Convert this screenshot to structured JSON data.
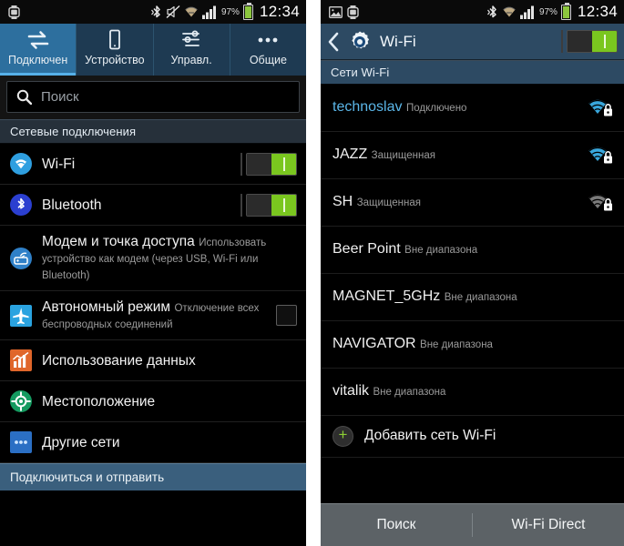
{
  "statusbar_left": {
    "time": "12:34",
    "battery_pct": "97%",
    "icons_left": [
      "gallery-icon",
      "watch-icon"
    ],
    "icons_right": [
      "bluetooth-icon",
      "mute-icon",
      "wifi-icon",
      "signal-icon"
    ]
  },
  "statusbar_right": {
    "time": "12:34",
    "battery_pct": "97%",
    "icons_left": [
      "gallery-icon",
      "watch-icon"
    ],
    "icons_right": [
      "bluetooth-icon",
      "wifi-icon",
      "signal-icon"
    ]
  },
  "left_screen": {
    "tabs": [
      {
        "label": "Подключен",
        "icon": "connections-arrows-icon",
        "active": true
      },
      {
        "label": "Устройство",
        "icon": "device-phone-icon",
        "active": false
      },
      {
        "label": "Управл.",
        "icon": "sliders-icon",
        "active": false
      },
      {
        "label": "Общие",
        "icon": "more-dots-icon",
        "active": false
      }
    ],
    "search": {
      "placeholder": "Поиск",
      "icon": "search-icon",
      "value": ""
    },
    "section_title": "Сетевые подключения",
    "rows": [
      {
        "title": "Wi-Fi",
        "sub": "",
        "icon": "wifi-round-icon",
        "control": "toggle-on"
      },
      {
        "title": "Bluetooth",
        "sub": "",
        "icon": "bluetooth-round-icon",
        "control": "toggle-on"
      },
      {
        "title": "Модем и точка доступа",
        "sub": "Использовать устройство как модем (через USB, Wi-Fi или Bluetooth)",
        "icon": "tethering-round-icon",
        "control": "none"
      },
      {
        "title": "Автономный режим",
        "sub": "Отключение всех беспроводных соединений",
        "icon": "airplane-square-icon",
        "control": "checkbox-off"
      },
      {
        "title": "Использование данных",
        "sub": "",
        "icon": "data-usage-square-icon",
        "control": "none"
      },
      {
        "title": "Местоположение",
        "sub": "",
        "icon": "location-round-icon",
        "control": "none"
      },
      {
        "title": "Другие сети",
        "sub": "",
        "icon": "more-networks-square-icon",
        "control": "none"
      }
    ],
    "bottom_bar": "Подключиться и отправить"
  },
  "right_screen": {
    "header": {
      "title": "Wi-Fi",
      "back_icon": "back-chevron-icon",
      "gear_icon": "wifi-settings-gear-icon",
      "toggle": "toggle-on"
    },
    "section_title": "Сети Wi-Fi",
    "networks": [
      {
        "ssid": "technoslav",
        "state": "Подключено",
        "connected": true,
        "signal": "wifi-signal-strong-icon",
        "secured": true,
        "dim": false
      },
      {
        "ssid": "JAZZ",
        "state": "Защищенная",
        "connected": false,
        "signal": "wifi-signal-strong-icon",
        "secured": true,
        "dim": false
      },
      {
        "ssid": "SH",
        "state": "Защищенная",
        "connected": false,
        "signal": "wifi-signal-grey-icon",
        "secured": true,
        "dim": true
      },
      {
        "ssid": "Beer Point",
        "state": "Вне диапазона",
        "connected": false,
        "signal": "none",
        "secured": false,
        "dim": false
      },
      {
        "ssid": "MAGNET_5GHz",
        "state": "Вне диапазона",
        "connected": false,
        "signal": "none",
        "secured": false,
        "dim": false
      },
      {
        "ssid": "NAVIGATOR",
        "state": "Вне диапазона",
        "connected": false,
        "signal": "none",
        "secured": false,
        "dim": false
      },
      {
        "ssid": "vitalik",
        "state": "Вне диапазона",
        "connected": false,
        "signal": "none",
        "secured": false,
        "dim": false
      }
    ],
    "add_network": {
      "label": "Добавить сеть Wi-Fi",
      "icon": "plus-icon"
    },
    "bottom_buttons": [
      {
        "label": "Поиск"
      },
      {
        "label": "Wi-Fi Direct"
      }
    ]
  },
  "colors": {
    "accent_blue": "#2d6f9e",
    "header_blue": "#2d4a63",
    "toggle_green": "#7ac61f",
    "connected_blue": "#5bb6e8",
    "battery_green": "#8cc63e"
  }
}
